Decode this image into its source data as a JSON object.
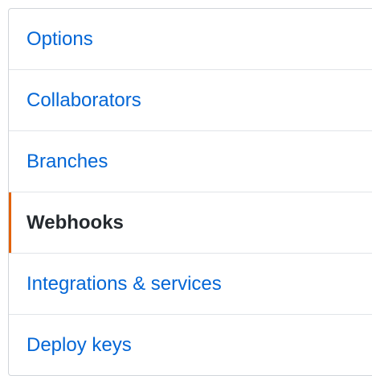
{
  "settings_menu": {
    "items": [
      {
        "label": "Options",
        "selected": false
      },
      {
        "label": "Collaborators",
        "selected": false
      },
      {
        "label": "Branches",
        "selected": false
      },
      {
        "label": "Webhooks",
        "selected": true
      },
      {
        "label": "Integrations & services",
        "selected": false
      },
      {
        "label": "Deploy keys",
        "selected": false
      }
    ]
  },
  "colors": {
    "link": "#0366d6",
    "selected_text": "#24292e",
    "selected_indicator": "#e36209",
    "border": "#d1d5da"
  }
}
